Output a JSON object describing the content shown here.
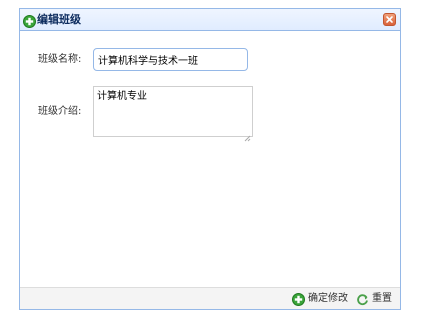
{
  "dialog": {
    "title": "编辑班级",
    "icons": {
      "title": "green-add-icon",
      "close": "close-icon"
    }
  },
  "form": {
    "name_label": "班级名称:",
    "name_value": "计算机科学与技术一班",
    "intro_label": "班级介绍:",
    "intro_value": "计算机专业"
  },
  "footer": {
    "confirm_label": "确定修改",
    "reset_label": "重置",
    "icons": {
      "confirm": "green-add-icon",
      "reset": "reload-icon"
    }
  },
  "colors": {
    "border": "#95b8e7",
    "title_bg": "#e0ecff",
    "close_bg": "#d9623a",
    "footer_bg": "#f4f4f4"
  }
}
